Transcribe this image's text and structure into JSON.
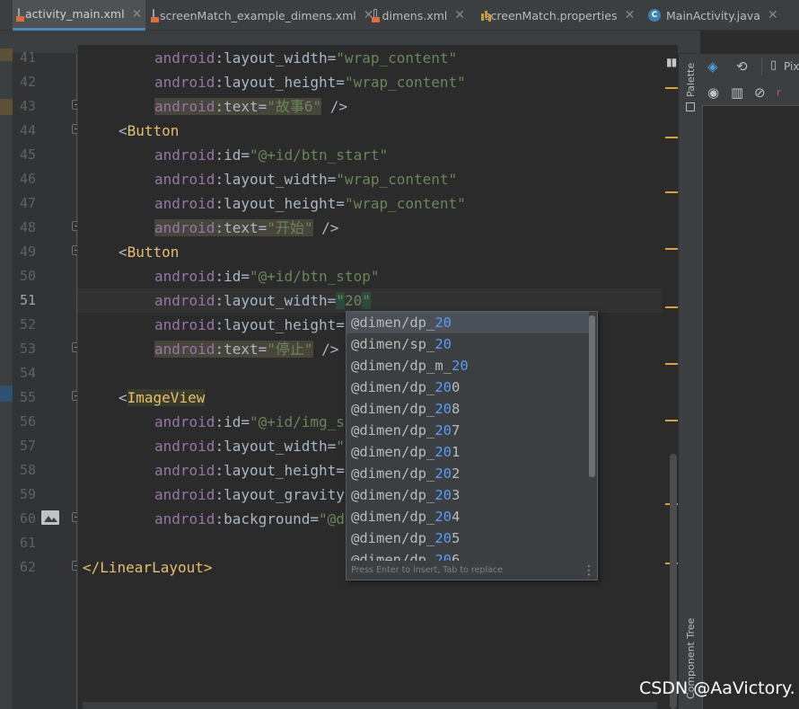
{
  "tabs": [
    {
      "label": "activity_main.xml",
      "icon": "xml-file-icon",
      "active": true
    },
    {
      "label": "screenMatch_example_dimens.xml",
      "icon": "xml-file-icon",
      "active": false
    },
    {
      "label": "dimens.xml",
      "icon": "xml-file-icon",
      "active": false
    },
    {
      "label": "screenMatch.properties",
      "icon": "properties-file-icon",
      "active": false
    },
    {
      "label": "MainActivity.java",
      "icon": "java-class-icon",
      "active": false
    }
  ],
  "line_numbers": [
    "41",
    "42",
    "43",
    "44",
    "45",
    "46",
    "47",
    "48",
    "49",
    "50",
    "51",
    "52",
    "53",
    "54",
    "55",
    "56",
    "57",
    "58",
    "59",
    "60",
    "61",
    "62"
  ],
  "code": {
    "l41": {
      "ns": "android",
      "attr": ":layout_width=",
      "val": "\"wrap_content\""
    },
    "l42": {
      "ns": "android",
      "attr": ":layout_height=",
      "val": "\"wrap_content\""
    },
    "l43": {
      "ns": "android",
      "attr": ":text=",
      "val": "\"故事6\"",
      "end": " />"
    },
    "l44": {
      "lt": "<",
      "tag": "Button"
    },
    "l45": {
      "ns": "android",
      "attr": ":id=",
      "val": "\"@+id/btn_start\""
    },
    "l46": {
      "ns": "android",
      "attr": ":layout_width=",
      "val": "\"wrap_content\""
    },
    "l47": {
      "ns": "android",
      "attr": ":layout_height=",
      "val": "\"wrap_content\""
    },
    "l48": {
      "ns": "android",
      "attr": ":text=",
      "val": "\"开始\"",
      "end": " />"
    },
    "l49": {
      "lt": "<",
      "tag": "Button"
    },
    "l50": {
      "ns": "android",
      "attr": ":id=",
      "val": "\"@+id/btn_stop\""
    },
    "l51": {
      "ns": "android",
      "attr": ":layout_width=",
      "q1": "\"",
      "val": "20",
      "q2": "\""
    },
    "l52": {
      "ns": "android",
      "attr": ":layout_height="
    },
    "l53": {
      "ns": "android",
      "attr": ":text=",
      "val": "\"停止\"",
      "end": " />"
    },
    "l55": {
      "lt": "<",
      "tag": "ImageView"
    },
    "l56": {
      "ns": "android",
      "attr": ":id=",
      "val": "\"@+id/img_s"
    },
    "l57": {
      "ns": "android",
      "attr": ":layout_width=",
      "val": "\""
    },
    "l58": {
      "ns": "android",
      "attr": ":layout_height="
    },
    "l59": {
      "ns": "android",
      "attr": ":layout_gravity"
    },
    "l60": {
      "ns": "android",
      "attr": ":background=",
      "val": "\"@d"
    },
    "l62": {
      "text": "</LinearLayout>"
    }
  },
  "autocomplete": {
    "items": [
      {
        "pre": "@dimen/dp_",
        "match": "20",
        "post": ""
      },
      {
        "pre": "@dimen/sp_",
        "match": "20",
        "post": ""
      },
      {
        "pre": "@dimen/dp_m_",
        "match": "20",
        "post": ""
      },
      {
        "pre": "@dimen/dp_",
        "match": "20",
        "post": "0"
      },
      {
        "pre": "@dimen/dp_",
        "match": "20",
        "post": "8"
      },
      {
        "pre": "@dimen/dp_",
        "match": "20",
        "post": "7"
      },
      {
        "pre": "@dimen/dp_",
        "match": "20",
        "post": "1"
      },
      {
        "pre": "@dimen/dp_",
        "match": "20",
        "post": "2"
      },
      {
        "pre": "@dimen/dp_",
        "match": "20",
        "post": "3"
      },
      {
        "pre": "@dimen/dp_",
        "match": "20",
        "post": "4"
      },
      {
        "pre": "@dimen/dp_",
        "match": "20",
        "post": "5"
      },
      {
        "pre": "@dimen/dp_",
        "match": "20",
        "post": "6"
      }
    ],
    "footer": "Press Enter to insert, Tab to replace",
    "menu_icon": "more-vertical-icon"
  },
  "side_labels": {
    "palette": "Palette",
    "component_tree": "Component Tree"
  },
  "right_panel": {
    "pix_label": "Pix",
    "more_label": "r"
  },
  "watermark": "CSDN @AaVictory.",
  "colors": {
    "attr_ns": "#9876aa",
    "value": "#6a8759",
    "tag": "#e8bf6a",
    "text": "#a9b7c6",
    "match": "#589df6",
    "tab_accent": "#4a88c7"
  }
}
